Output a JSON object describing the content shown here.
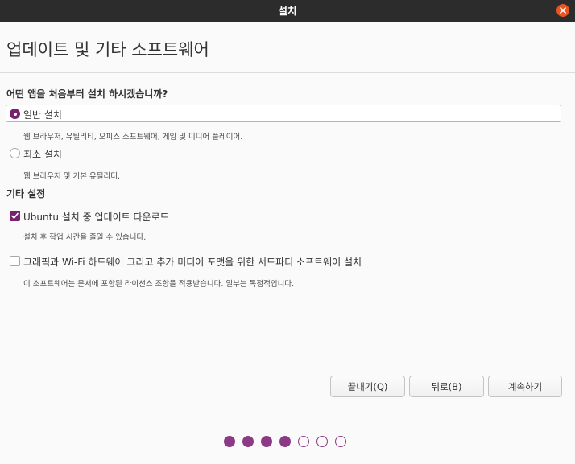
{
  "window": {
    "title": "설치"
  },
  "page": {
    "title": "업데이트 및 기타 소프트웨어"
  },
  "install_type": {
    "question": "어떤 앱을 처음부터 설치 하시겠습니까?",
    "options": [
      {
        "label": "일반 설치",
        "description": "웹 브라우저, 유틸리티, 오피스 소프트웨어, 게임 및 미디어 플레이어.",
        "selected": true
      },
      {
        "label": "최소 설치",
        "description": "웹 브라우저 및 기본 유틸리티.",
        "selected": false
      }
    ]
  },
  "other": {
    "heading": "기타 설정",
    "options": [
      {
        "label": "Ubuntu 설치 중 업데이트 다운로드",
        "description": "설치 후 작업 시간을 줄일 수 있습니다.",
        "checked": true
      },
      {
        "label": "그래픽과 Wi-Fi 하드웨어 그리고 추가 미디어 포맷을 위한 서드파티 소프트웨어 설치",
        "description": "이 소프트웨어는 문서에 포함된 라이선스 조항을 적용받습니다. 일부는 독점적입니다.",
        "checked": false
      }
    ]
  },
  "buttons": {
    "quit": "끝내기(Q)",
    "back": "뒤로(B)",
    "continue": "계속하기"
  },
  "progress": {
    "total_steps": 7,
    "completed_steps": 4
  },
  "colors": {
    "accent": "#77216f",
    "close": "#e95420",
    "focus_border": "#f0a07f",
    "titlebar": "#2c2c2c"
  }
}
